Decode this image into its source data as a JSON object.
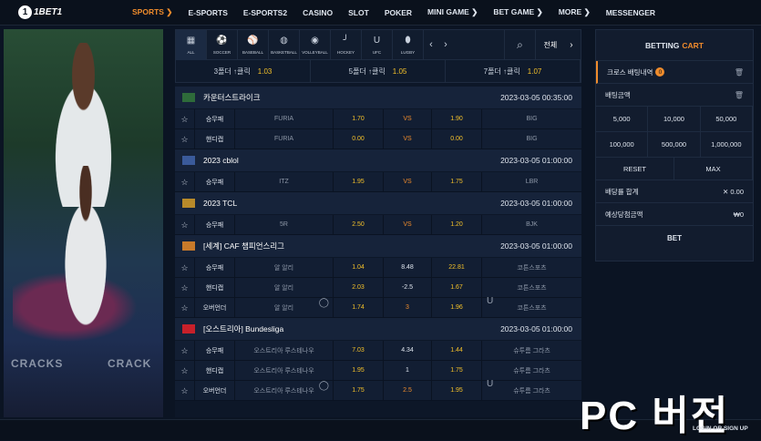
{
  "logo": {
    "mark": "1",
    "text": "1BET1"
  },
  "nav": [
    {
      "label": "SPORTS ❯",
      "active": true
    },
    {
      "label": "E-SPORTS"
    },
    {
      "label": "E-SPORTS2"
    },
    {
      "label": "CASINO"
    },
    {
      "label": "SLOT"
    },
    {
      "label": "POKER"
    },
    {
      "label": "MINI GAME ❯"
    },
    {
      "label": "BET GAME ❯"
    },
    {
      "label": "MORE ❯"
    },
    {
      "label": "MESSENGER"
    }
  ],
  "banner": {
    "left_text": "CRACKS",
    "right_text": "CRACK"
  },
  "sports": [
    {
      "label": "ALL",
      "icon": "▦"
    },
    {
      "label": "SOCCER",
      "icon": "⚽"
    },
    {
      "label": "BASEBALL",
      "icon": "⚾"
    },
    {
      "label": "BASKETBALL",
      "icon": "◍"
    },
    {
      "label": "VOLLEYBALL",
      "icon": "◉"
    },
    {
      "label": "HOCKEY",
      "icon": "╯"
    },
    {
      "label": "UFC",
      "icon": "U"
    },
    {
      "label": "LUGBY",
      "icon": "⬮"
    }
  ],
  "sports_nav": {
    "prev": "‹",
    "next": "›",
    "all_label": "전체",
    "all_chevron": "›"
  },
  "folders": [
    {
      "label": "3폴더 ↑클릭",
      "value": "1.03"
    },
    {
      "label": "5폴더 ↑클릭",
      "value": "1.05"
    },
    {
      "label": "7폴더 ↑클릭",
      "value": "1.07"
    }
  ],
  "leagues": [
    {
      "name": "카운터스트라이크",
      "date": "2023-03-05 00:35:00",
      "flag": "#2e6b3a",
      "rows": [
        {
          "type": "승무패",
          "home": "FURIA",
          "o1": "1.70",
          "mid": "VS",
          "o2": "1.90",
          "away": "BIG"
        },
        {
          "type": "핸디캡",
          "home": "FURIA",
          "o1": "0.00",
          "mid": "VS",
          "o2": "0.00",
          "away": "BIG"
        }
      ]
    },
    {
      "name": "2023 cblol",
      "date": "2023-03-05 01:00:00",
      "flag": "#3a5a9a",
      "rows": [
        {
          "type": "승무패",
          "home": "ITZ",
          "o1": "1.95",
          "mid": "VS",
          "o2": "1.75",
          "away": "LBR"
        }
      ]
    },
    {
      "name": "2023 TCL",
      "date": "2023-03-05 01:00:00",
      "flag": "#b88a2a",
      "rows": [
        {
          "type": "승무패",
          "home": "5R",
          "o1": "2.50",
          "mid": "VS",
          "o2": "1.20",
          "away": "BJK"
        }
      ]
    },
    {
      "name": "[세계] CAF 챔피언스리그",
      "date": "2023-03-05 01:00:00",
      "flag": "#c87a2a",
      "rows": [
        {
          "type": "승무패",
          "home": "알 알리",
          "o1": "1.04",
          "mid": "8.48",
          "o2": "22.81",
          "away": "코튼스포츠"
        },
        {
          "type": "핸디캡",
          "home": "알 알리",
          "o1": "2.03",
          "mid": "-2.5",
          "o2": "1.67",
          "away": "코튼스포츠"
        },
        {
          "type": "오버언더",
          "home": "알 알리",
          "o1": "1.74",
          "mid": "3",
          "o2": "1.96",
          "away": "코튼스포츠",
          "ou": true
        }
      ]
    },
    {
      "name": "[오스트리아] Bundesliga",
      "date": "2023-03-05 01:00:00",
      "flag": "#c8202a",
      "rows": [
        {
          "type": "승무패",
          "home": "오스트리아 루스테나우",
          "o1": "7.03",
          "mid": "4.34",
          "o2": "1.44",
          "away": "슈투름 그라츠"
        },
        {
          "type": "핸디캡",
          "home": "오스트리아 루스테나우",
          "o1": "1.95",
          "mid": "1",
          "o2": "1.75",
          "away": "슈투름 그라츠"
        },
        {
          "type": "오버언더",
          "home": "오스트리아 루스테나우",
          "o1": "1.75",
          "mid": "2.5",
          "o2": "1.95",
          "away": "슈투름 그라츠",
          "ou": true
        }
      ]
    }
  ],
  "ou_icons": {
    "over": "◯",
    "under": "U"
  },
  "star_icon": "☆",
  "cart": {
    "title_a": "BETTING",
    "title_b": "CART",
    "history_label": "크로스 배팅내역",
    "history_count": "0",
    "amount_label": "배팅금액",
    "trash_icon": "🗑",
    "amounts": [
      "5,000",
      "10,000",
      "50,000",
      "100,000",
      "500,000",
      "1,000,000"
    ],
    "reset_label": "RESET",
    "max_label": "MAX",
    "odds_label": "배당률 합계",
    "odds_value": "✕ 0.00",
    "win_label": "예상당첨금액",
    "win_value": "₩0",
    "bet_label": "BET"
  },
  "overlay": {
    "pc_version": "PC 버전",
    "login": "LOGIN OR SIGN UP"
  },
  "colors": {
    "accent": "#f08c2c",
    "odds": "#f3c02a",
    "bg": "#0b1423"
  }
}
